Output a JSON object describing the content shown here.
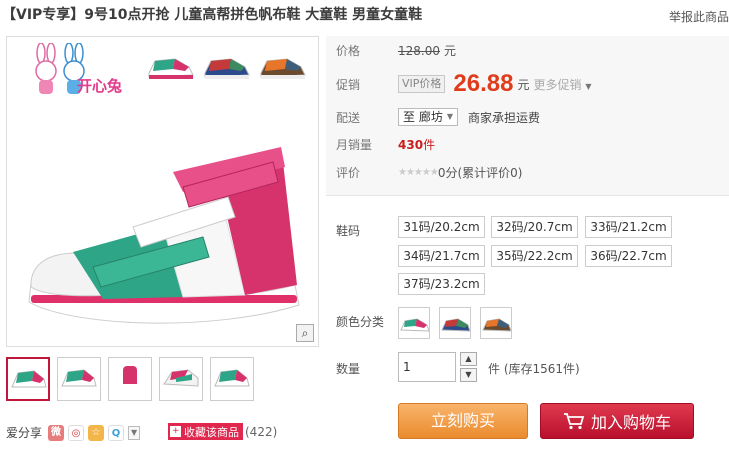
{
  "title": "【VIP专享】9号10点开抢 儿童高帮拼色帆布鞋 大童鞋 男童女童鞋",
  "report_link": "举报此商品",
  "gallery": {
    "logo_text": "开心兔",
    "zoom_icon": "magnifier-icon"
  },
  "share": {
    "label": "爱分享",
    "icons": [
      "sina-weibo-icon",
      "renren-icon",
      "kaixin-icon",
      "qzone-icon",
      "more-share-icon"
    ]
  },
  "favorite": {
    "label": "收藏该商品",
    "count": "(422)"
  },
  "info": {
    "price_label": "价格",
    "original_price": "128.00",
    "currency_unit": "元",
    "promo_label": "促销",
    "vip_tag": "VIP价格",
    "promo_price": "26.88",
    "promo_unit": "元",
    "more_promo": "更多促销",
    "shipping_label": "配送",
    "shipping_to": "至 廊坊",
    "shipping_note": "商家承担运费",
    "monthly_sales_label": "月销量",
    "monthly_sales": "430",
    "monthly_sales_unit": "件",
    "rating_label": "评价",
    "rating_stars": "★★★★★",
    "rating_text": "0分(累计评价0)"
  },
  "options": {
    "size_label": "鞋码",
    "sizes": [
      "31码/20.2cm",
      "32码/20.7cm",
      "33码/21.2cm",
      "34码/21.7cm",
      "35码/22.2cm",
      "36码/22.7cm",
      "37码/23.2cm"
    ],
    "color_label": "颜色分类",
    "quantity_label": "数量",
    "quantity_value": "1",
    "stock_text": "件 (库存1561件)"
  },
  "actions": {
    "buy_now": "立刻购买",
    "add_to_cart": "加入购物车"
  },
  "colors": {
    "accent_red": "#e03c1b",
    "cart_red": "#b90f2d",
    "buy_orange": "#ea8b2e",
    "shoe_pink": "#d6336c",
    "shoe_green": "#2fa587"
  }
}
